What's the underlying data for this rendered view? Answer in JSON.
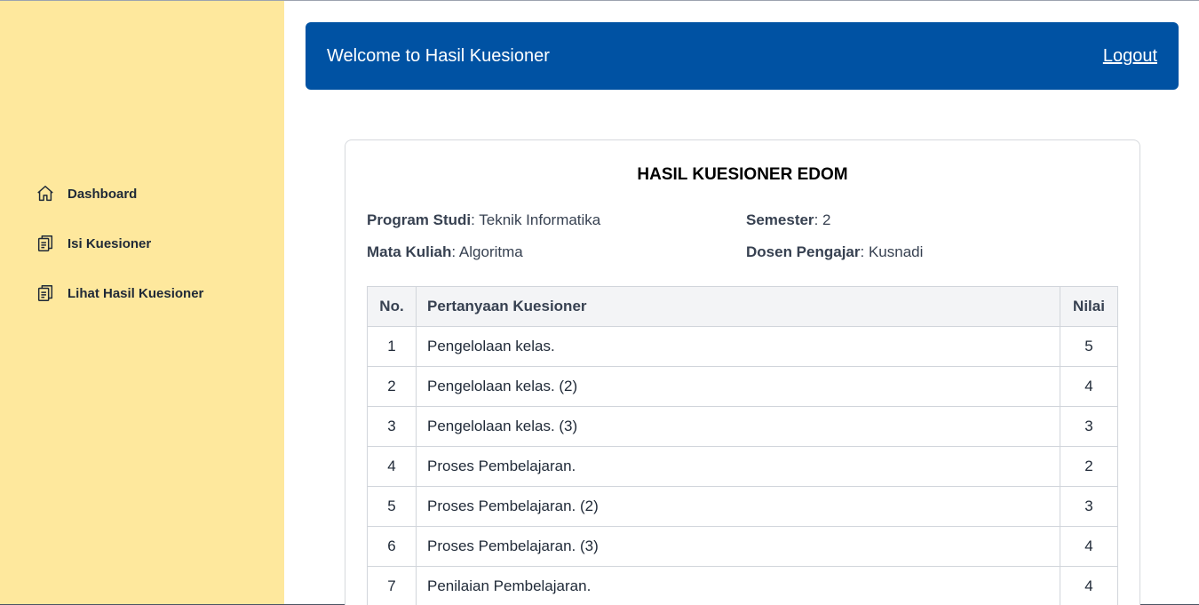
{
  "sidebar": {
    "items": [
      {
        "label": "Dashboard",
        "icon": "home-icon"
      },
      {
        "label": "Isi Kuesioner",
        "icon": "clipboard-icon"
      },
      {
        "label": "Lihat Hasil Kuesioner",
        "icon": "clipboard-icon"
      }
    ]
  },
  "header": {
    "title": "Welcome to Hasil Kuesioner",
    "logout": "Logout"
  },
  "card": {
    "title": "HASIL KUESIONER EDOM",
    "program_studi_label": "Program Studi",
    "program_studi_value": ": Teknik Informatika",
    "semester_label": "Semester",
    "semester_value": ": 2",
    "mata_kuliah_label": "Mata Kuliah",
    "mata_kuliah_value": ": Algoritma",
    "dosen_label": "Dosen Pengajar",
    "dosen_value": ": Kusnadi"
  },
  "table": {
    "headers": [
      "No.",
      "Pertanyaan Kuesioner",
      "Nilai"
    ],
    "rows": [
      [
        "1",
        "Pengelolaan kelas.",
        "5"
      ],
      [
        "2",
        "Pengelolaan kelas. (2)",
        "4"
      ],
      [
        "3",
        "Pengelolaan kelas. (3)",
        "3"
      ],
      [
        "4",
        "Proses Pembelajaran.",
        "2"
      ],
      [
        "5",
        "Proses Pembelajaran. (2)",
        "3"
      ],
      [
        "6",
        "Proses Pembelajaran. (3)",
        "4"
      ],
      [
        "7",
        "Penilaian Pembelajaran.",
        "4"
      ]
    ]
  },
  "colors": {
    "sidebar_bg": "#fee89d",
    "header_bg": "#0052a3"
  }
}
